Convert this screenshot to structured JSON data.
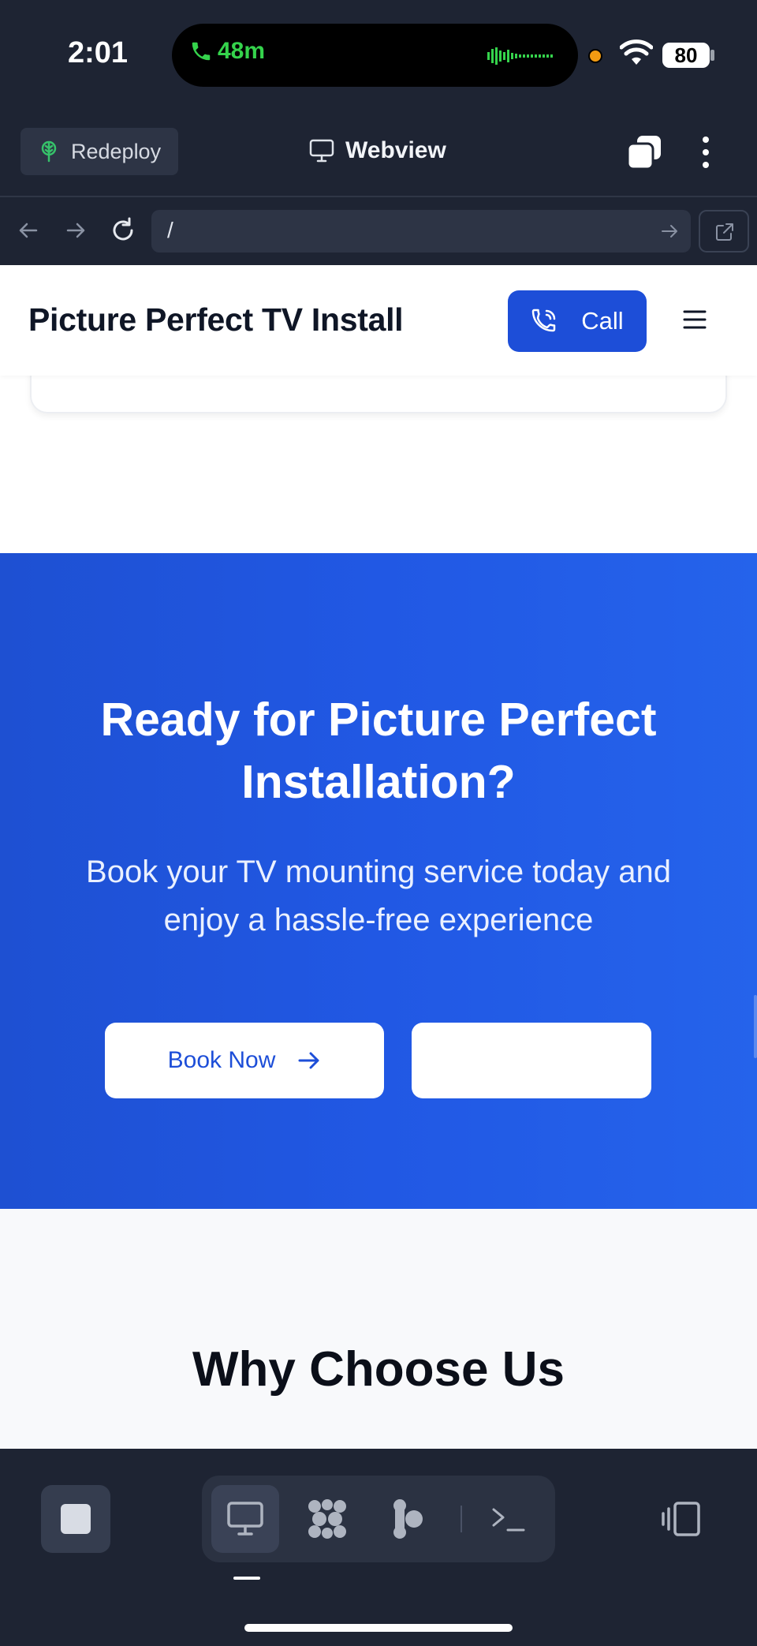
{
  "status_bar": {
    "time": "2:01",
    "call_duration": "48m",
    "battery": "80"
  },
  "toolbar": {
    "redeploy_label": "Redeploy",
    "webview_label": "Webview"
  },
  "url_bar": {
    "value": "/"
  },
  "site": {
    "brand": "Picture Perfect TV Install",
    "call_label": "Call",
    "cta": {
      "title": "Ready for Picture Perfect Installation?",
      "subtitle": "Book your TV mounting service today and enjoy a hassle-free experience",
      "book_label": "Book Now"
    },
    "why": {
      "title": "Why Choose Us"
    }
  },
  "colors": {
    "accent": "#1d4ed8",
    "cta_bg": "#2563eb",
    "chrome_bg": "#1e2433",
    "call_green": "#35d34c"
  }
}
